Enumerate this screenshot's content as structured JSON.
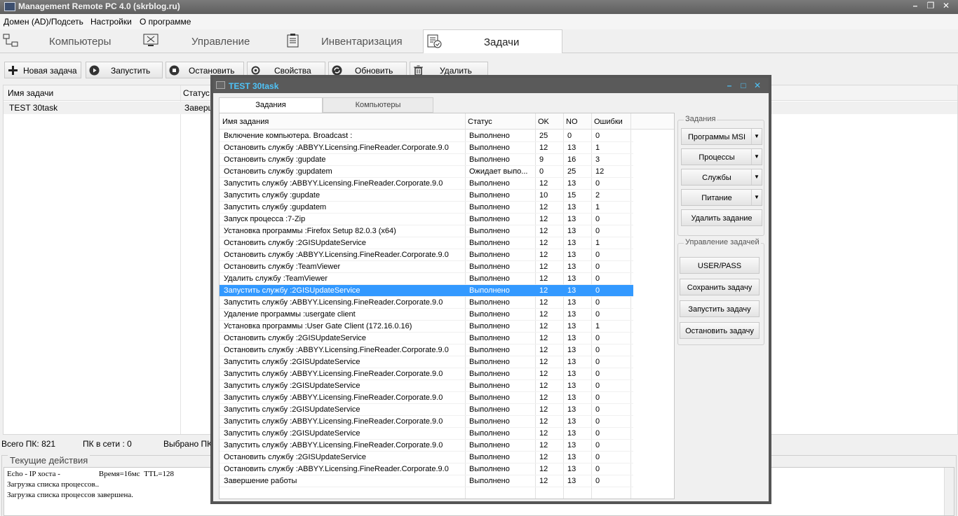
{
  "window": {
    "title": "Management Remote PC 4.0 (skrblog.ru)",
    "controls": [
      "–",
      "❐",
      "✕"
    ]
  },
  "menu": [
    "Домен (AD)/Подсеть",
    "Настройки",
    "О программе"
  ],
  "main_tabs": [
    {
      "label": "Компьютеры",
      "icon": "network-icon",
      "active": false
    },
    {
      "label": "Управление",
      "icon": "remote-control-icon",
      "active": false
    },
    {
      "label": "Инвентаризация",
      "icon": "clipboard-icon",
      "active": false
    },
    {
      "label": "Задачи",
      "icon": "task-list-icon",
      "active": true
    }
  ],
  "toolbar": {
    "new_task": "Новая задача",
    "start": "Запустить",
    "stop": "Остановить",
    "properties": "Свойства",
    "refresh": "Обновить",
    "delete": "Удалить"
  },
  "task_table": {
    "headers": [
      "Имя задачи",
      "Статус"
    ],
    "rows": [
      {
        "name": "TEST 30task",
        "status": "Заверш"
      }
    ]
  },
  "status_bar": {
    "total": "Всего ПК: 821",
    "online": "ПК в сети : 0",
    "selected": "Выбрано ПК"
  },
  "current_actions": {
    "legend": "Текущие действия",
    "lines": [
      "Echo - IP хоста -                    Время=16мс  TTL=128",
      "Загрузка списка процессов..",
      "Загрузка списка процессов завершена."
    ]
  },
  "dialog": {
    "title": "TEST 30task",
    "controls": [
      "–",
      "□",
      "✕"
    ],
    "tabs": [
      "Задания",
      "Компьютеры"
    ],
    "grid_headers": [
      "Имя задания",
      "Статус",
      "OK",
      "NO",
      "Ошибки"
    ],
    "rows": [
      [
        "Включение компьютера. Broadcast :",
        "Выполнено",
        "25",
        "0",
        "0"
      ],
      [
        "Остановить службу :ABBYY.Licensing.FineReader.Corporate.9.0",
        "Выполнено",
        "12",
        "13",
        "1"
      ],
      [
        "Остановить службу :gupdate",
        "Выполнено",
        "9",
        "16",
        "3"
      ],
      [
        "Остановить службу :gupdatem",
        "Ожидает выпо...",
        "0",
        "25",
        "12"
      ],
      [
        "Запустить службу :ABBYY.Licensing.FineReader.Corporate.9.0",
        "Выполнено",
        "12",
        "13",
        "0"
      ],
      [
        "Запустить службу :gupdate",
        "Выполнено",
        "10",
        "15",
        "2"
      ],
      [
        "Запустить службу :gupdatem",
        "Выполнено",
        "12",
        "13",
        "1"
      ],
      [
        "Запуск процесса :7-Zip",
        "Выполнено",
        "12",
        "13",
        "0"
      ],
      [
        "Установка программы :Firefox Setup 82.0.3 (x64)",
        "Выполнено",
        "12",
        "13",
        "0"
      ],
      [
        "Остановить службу :2GISUpdateService",
        "Выполнено",
        "12",
        "13",
        "1"
      ],
      [
        "Остановить службу :ABBYY.Licensing.FineReader.Corporate.9.0",
        "Выполнено",
        "12",
        "13",
        "0"
      ],
      [
        "Остановить службу :TeamViewer",
        "Выполнено",
        "12",
        "13",
        "0"
      ],
      [
        "Удалить службу :TeamViewer",
        "Выполнено",
        "12",
        "13",
        "0"
      ],
      [
        "Запустить службу :2GISUpdateService",
        "Выполнено",
        "12",
        "13",
        "0"
      ],
      [
        "Запустить службу :ABBYY.Licensing.FineReader.Corporate.9.0",
        "Выполнено",
        "12",
        "13",
        "0"
      ],
      [
        "Удаление программы :usergate client",
        "Выполнено",
        "12",
        "13",
        "0"
      ],
      [
        "Установка программы :User Gate Client (172.16.0.16)",
        "Выполнено",
        "12",
        "13",
        "1"
      ],
      [
        "Остановить службу :2GISUpdateService",
        "Выполнено",
        "12",
        "13",
        "0"
      ],
      [
        "Остановить службу :ABBYY.Licensing.FineReader.Corporate.9.0",
        "Выполнено",
        "12",
        "13",
        "0"
      ],
      [
        "Запустить службу :2GISUpdateService",
        "Выполнено",
        "12",
        "13",
        "0"
      ],
      [
        "Запустить службу :ABBYY.Licensing.FineReader.Corporate.9.0",
        "Выполнено",
        "12",
        "13",
        "0"
      ],
      [
        "Запустить службу :2GISUpdateService",
        "Выполнено",
        "12",
        "13",
        "0"
      ],
      [
        "Запустить службу :ABBYY.Licensing.FineReader.Corporate.9.0",
        "Выполнено",
        "12",
        "13",
        "0"
      ],
      [
        "Запустить службу :2GISUpdateService",
        "Выполнено",
        "12",
        "13",
        "0"
      ],
      [
        "Запустить службу :ABBYY.Licensing.FineReader.Corporate.9.0",
        "Выполнено",
        "12",
        "13",
        "0"
      ],
      [
        "Запустить службу :2GISUpdateService",
        "Выполнено",
        "12",
        "13",
        "0"
      ],
      [
        "Запустить службу :ABBYY.Licensing.FineReader.Corporate.9.0",
        "Выполнено",
        "12",
        "13",
        "0"
      ],
      [
        "Остановить службу :2GISUpdateService",
        "Выполнено",
        "12",
        "13",
        "0"
      ],
      [
        "Остановить службу :ABBYY.Licensing.FineReader.Corporate.9.0",
        "Выполнено",
        "12",
        "13",
        "0"
      ],
      [
        "Завершение работы",
        "Выполнено",
        "12",
        "13",
        "0"
      ]
    ],
    "selected_row": 13,
    "tasks_group": {
      "label": "Задания",
      "buttons": [
        {
          "label": "Программы MSI",
          "dropdown": true
        },
        {
          "label": "Процессы",
          "dropdown": true
        },
        {
          "label": "Службы",
          "dropdown": true
        },
        {
          "label": "Питание",
          "dropdown": true
        },
        {
          "label": "Удалить задание",
          "dropdown": false
        }
      ]
    },
    "control_group": {
      "label": "Управление задачей",
      "buttons": [
        "USER/PASS",
        "Сохранить задачу",
        "Запустить задачу",
        "Остановить задачу"
      ]
    }
  },
  "colors": {
    "selection": "#3399ff",
    "dialog_title_text": "#4fc3f7"
  }
}
